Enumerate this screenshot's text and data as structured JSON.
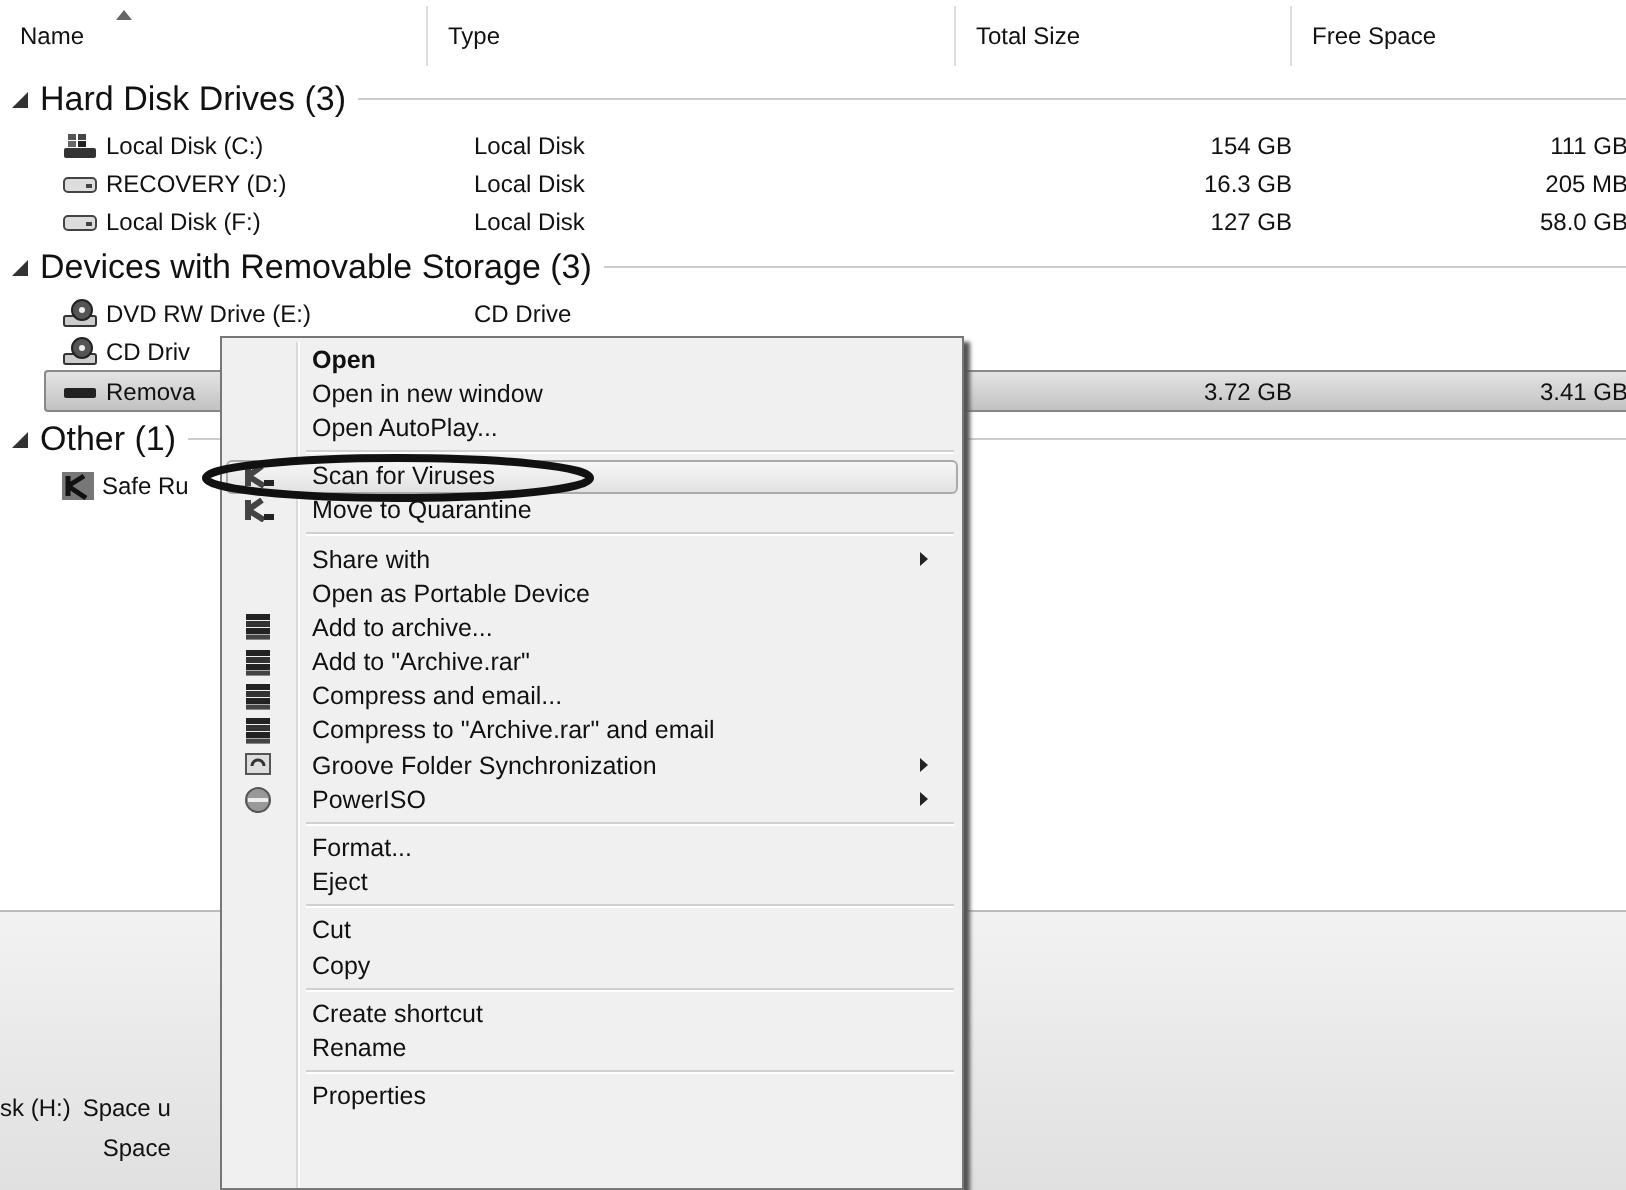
{
  "columns": [
    {
      "label": "Name",
      "sorted": true
    },
    {
      "label": "Type",
      "sorted": false
    },
    {
      "label": "Total Size",
      "sorted": false
    },
    {
      "label": "Free Space",
      "sorted": false
    }
  ],
  "groups": [
    {
      "title": "Hard Disk Drives (3)",
      "expanded": true,
      "rows": [
        {
          "kind": "system-drive",
          "name": "Local Disk (C:)",
          "type": "Local Disk",
          "total_size": "154 GB",
          "free_space": "111 GB",
          "selected": false
        },
        {
          "kind": "hdd",
          "name": "RECOVERY (D:)",
          "type": "Local Disk",
          "total_size": "16.3 GB",
          "free_space": "205 MB",
          "selected": false
        },
        {
          "kind": "hdd",
          "name": "Local Disk (F:)",
          "type": "Local Disk",
          "total_size": "127 GB",
          "free_space": "58.0 GB",
          "selected": false
        }
      ]
    },
    {
      "title": "Devices with Removable Storage (3)",
      "expanded": true,
      "rows": [
        {
          "kind": "optical",
          "name": "DVD RW Drive (E:)",
          "type": "CD Drive",
          "selected": false
        },
        {
          "kind": "optical",
          "name": "CD Driv",
          "selected": false
        },
        {
          "kind": "removable",
          "name": "Remova",
          "total_size": "3.72 GB",
          "free_space": "3.41 GB",
          "selected": true
        }
      ]
    },
    {
      "title": "Other (1)",
      "expanded": true,
      "rows": [
        {
          "kind": "app",
          "name": "Safe Ru",
          "selected": false
        }
      ]
    }
  ],
  "context_menu": {
    "sections": [
      {
        "items": [
          {
            "label": "Open",
            "bold": true,
            "submenu": false,
            "selected": false,
            "circled": false
          },
          {
            "label": "Open in new window",
            "bold": false,
            "submenu": false,
            "selected": false,
            "circled": false
          },
          {
            "label": "Open AutoPlay...",
            "bold": false,
            "submenu": false,
            "selected": false,
            "circled": false
          }
        ]
      },
      {
        "items": [
          {
            "label": "Scan for Viruses",
            "kind": "scan",
            "bold": false,
            "submenu": false,
            "selected": true,
            "circled": true
          },
          {
            "label": "Move to Quarantine",
            "kind": "scan",
            "bold": false,
            "submenu": false,
            "selected": false,
            "circled": false
          }
        ]
      },
      {
        "items": [
          {
            "label": "Share with",
            "bold": false,
            "submenu": true,
            "selected": false,
            "circled": false
          },
          {
            "label": "Open as Portable Device",
            "bold": false,
            "submenu": false,
            "selected": false,
            "circled": false
          },
          {
            "label": "Add to archive...",
            "kind": "archive",
            "bold": false,
            "submenu": false,
            "selected": false,
            "circled": false
          },
          {
            "label": "Add to \"Archive.rar\"",
            "kind": "archive",
            "bold": false,
            "submenu": false,
            "selected": false,
            "circled": false
          },
          {
            "label": "Compress and email...",
            "kind": "archive",
            "bold": false,
            "submenu": false,
            "selected": false,
            "circled": false
          },
          {
            "label": "Compress to \"Archive.rar\" and email",
            "kind": "archive",
            "bold": false,
            "submenu": false,
            "selected": false,
            "circled": false
          },
          {
            "label": "Groove Folder Synchronization",
            "kind": "groove",
            "bold": false,
            "submenu": true,
            "selected": false,
            "circled": false
          },
          {
            "label": "PowerISO",
            "kind": "disc",
            "bold": false,
            "submenu": true,
            "selected": false,
            "circled": false
          }
        ]
      },
      {
        "items": [
          {
            "label": "Format...",
            "bold": false,
            "submenu": false,
            "selected": false,
            "circled": false
          },
          {
            "label": "Eject",
            "bold": false,
            "submenu": false,
            "selected": false,
            "circled": false
          }
        ]
      },
      {
        "items": [
          {
            "label": "Cut",
            "bold": false,
            "submenu": false,
            "selected": false,
            "circled": false
          },
          {
            "label": "Copy",
            "bold": false,
            "submenu": false,
            "selected": false,
            "circled": false
          }
        ]
      },
      {
        "items": [
          {
            "label": "Create shortcut",
            "bold": false,
            "submenu": false,
            "selected": false,
            "circled": false
          },
          {
            "label": "Rename",
            "bold": false,
            "submenu": false,
            "selected": false,
            "circled": false
          }
        ]
      },
      {
        "items": [
          {
            "label": "Properties",
            "bold": false,
            "submenu": false,
            "selected": false,
            "circled": false
          }
        ]
      }
    ]
  },
  "status_bar": {
    "drive": "sk (H:)",
    "fields": [
      "Space u",
      "Space"
    ]
  }
}
